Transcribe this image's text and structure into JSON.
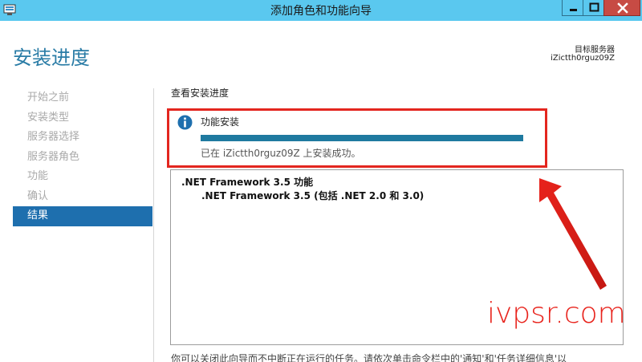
{
  "window": {
    "title": "添加角色和功能向导"
  },
  "header": {
    "page_title": "安装进度",
    "server_label": "目标服务器",
    "server_name": "iZictth0rguz09Z"
  },
  "nav": {
    "items": [
      {
        "label": "开始之前",
        "active": false
      },
      {
        "label": "安装类型",
        "active": false
      },
      {
        "label": "服务器选择",
        "active": false
      },
      {
        "label": "服务器角色",
        "active": false
      },
      {
        "label": "功能",
        "active": false
      },
      {
        "label": "确认",
        "active": false
      },
      {
        "label": "结果",
        "active": true
      }
    ]
  },
  "content": {
    "heading": "查看安装进度",
    "feature_label": "功能安装",
    "progress": 1.0,
    "status_text": "已在 iZictth0rguz09Z 上安装成功。",
    "results": {
      "feature": ".NET Framework 3.5 功能",
      "subfeature": ".NET Framework 3.5 (包括 .NET 2.0 和 3.0)"
    },
    "bottom_text": "你可以关闭此向导而不中断正在运行的任务。请依次单击命令栏中的'通知'和'任务详细信息'以"
  },
  "annotation": {
    "watermark": "ivpsr.com",
    "color": "#e8231c"
  }
}
